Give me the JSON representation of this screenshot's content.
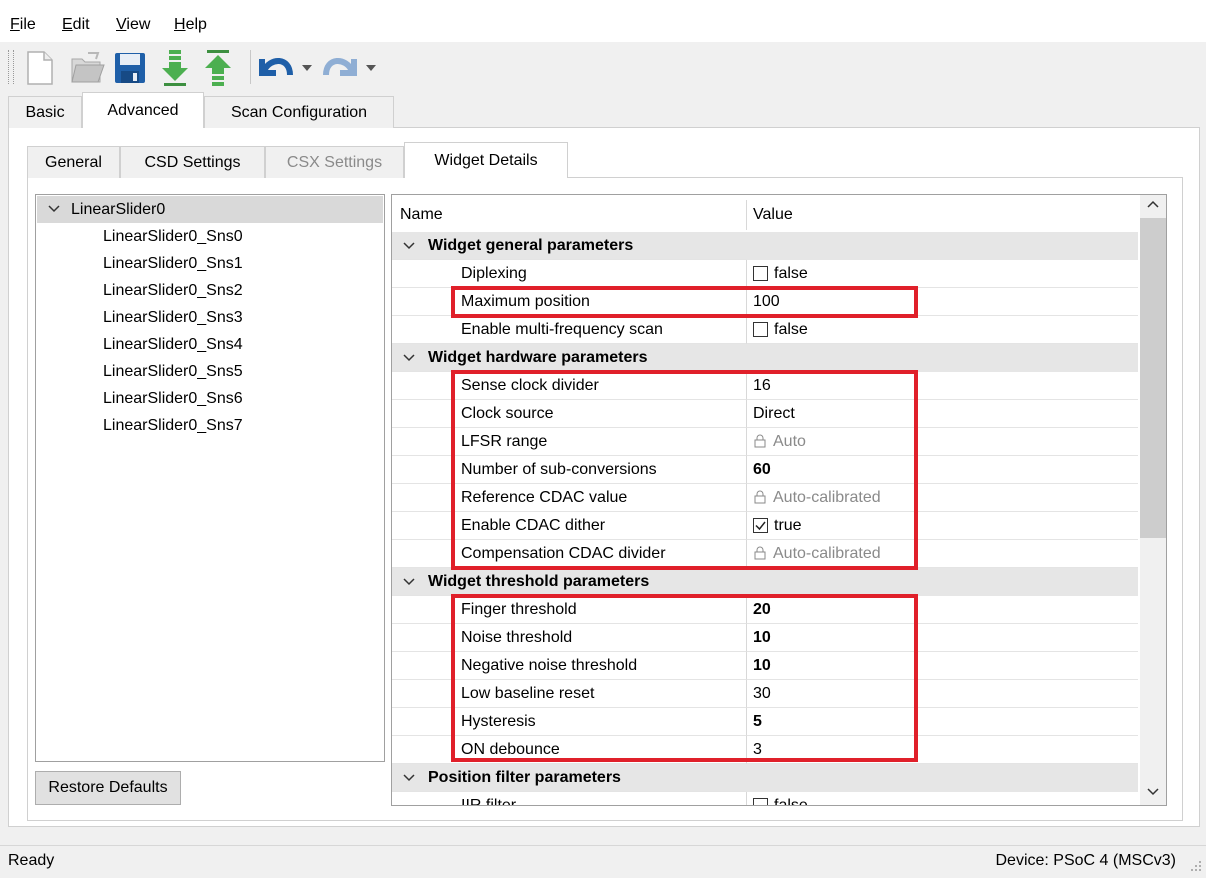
{
  "menu": {
    "file": {
      "mnemonic": "F",
      "rest": "ile"
    },
    "edit": {
      "mnemonic": "E",
      "rest": "dit"
    },
    "view": {
      "mnemonic": "V",
      "rest": "iew"
    },
    "help": {
      "mnemonic": "H",
      "rest": "elp"
    }
  },
  "toolbar": {
    "icons": [
      "new-icon",
      "open-icon",
      "save-icon",
      "import-icon",
      "export-icon",
      "undo-icon",
      "redo-icon"
    ]
  },
  "tabs": [
    "Basic",
    "Advanced",
    "Scan Configuration"
  ],
  "subtabs": [
    "General",
    "CSD Settings",
    "CSX Settings",
    "Widget Details"
  ],
  "tree": {
    "root": "LinearSlider0",
    "children": [
      "LinearSlider0_Sns0",
      "LinearSlider0_Sns1",
      "LinearSlider0_Sns2",
      "LinearSlider0_Sns3",
      "LinearSlider0_Sns4",
      "LinearSlider0_Sns5",
      "LinearSlider0_Sns6",
      "LinearSlider0_Sns7"
    ]
  },
  "restore_defaults": "Restore Defaults",
  "grid": {
    "col_name": "Name",
    "col_value": "Value",
    "groups": [
      {
        "title": "Widget general parameters"
      },
      {
        "title": "Widget hardware parameters"
      },
      {
        "title": "Widget threshold parameters"
      },
      {
        "title": "Position filter parameters"
      }
    ],
    "rows": [
      {
        "name": "Diplexing",
        "value": "false"
      },
      {
        "name": "Maximum position",
        "value": "100"
      },
      {
        "name": "Enable multi-frequency scan",
        "value": "false"
      },
      {
        "name": "Sense clock divider",
        "value": "16"
      },
      {
        "name": "Clock source",
        "value": "Direct"
      },
      {
        "name": "LFSR range",
        "value": "Auto"
      },
      {
        "name": "Number of sub-conversions",
        "value": "60"
      },
      {
        "name": "Reference CDAC value",
        "value": "Auto-calibrated"
      },
      {
        "name": "Enable CDAC dither",
        "value": "true"
      },
      {
        "name": "Compensation CDAC divider",
        "value": "Auto-calibrated"
      },
      {
        "name": "Finger threshold",
        "value": "20"
      },
      {
        "name": "Noise threshold",
        "value": "10"
      },
      {
        "name": "Negative noise threshold",
        "value": "10"
      },
      {
        "name": "Low baseline reset",
        "value": "30"
      },
      {
        "name": "Hysteresis",
        "value": "5"
      },
      {
        "name": "ON debounce",
        "value": "3"
      },
      {
        "name": "IIR filter",
        "value": "false"
      }
    ]
  },
  "status": {
    "left": "Ready",
    "right": "Device: PSoC 4 (MSCv3)"
  },
  "colors": {
    "highlight": "#e0202a",
    "group_bg": "#e6e6e6"
  }
}
